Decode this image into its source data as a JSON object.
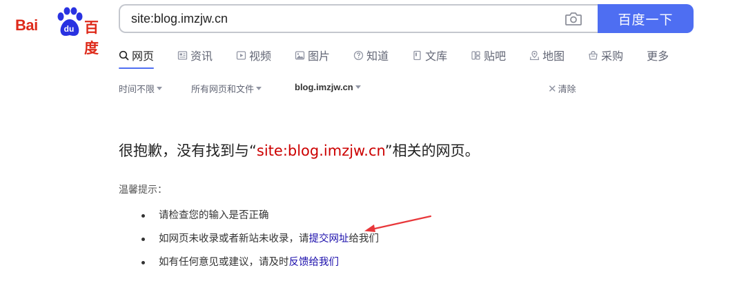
{
  "logo": {
    "text_left": "Bai",
    "paw_text": "du",
    "text_cn": "百度"
  },
  "search": {
    "query": "site:blog.imzjw.cn",
    "button_label": "百度一下",
    "camera_icon": "camera-icon"
  },
  "tabs": [
    {
      "label": "网页",
      "icon": "search-icon",
      "active": true
    },
    {
      "label": "资讯",
      "icon": "news-icon"
    },
    {
      "label": "视频",
      "icon": "video-icon"
    },
    {
      "label": "图片",
      "icon": "image-icon"
    },
    {
      "label": "知道",
      "icon": "question-icon"
    },
    {
      "label": "文库",
      "icon": "document-icon"
    },
    {
      "label": "贴吧",
      "icon": "tieba-icon"
    },
    {
      "label": "地图",
      "icon": "map-icon"
    },
    {
      "label": "采购",
      "icon": "basket-icon"
    },
    {
      "label": "更多"
    }
  ],
  "filters": {
    "time": "时间不限",
    "filetype": "所有网页和文件",
    "site": "blog.imzjw.cn",
    "clear": "清除"
  },
  "result": {
    "prefix": "很抱歉，没有找到与“",
    "query": "site:blog.imzjw.cn",
    "suffix": "”相关的网页。"
  },
  "tips": {
    "title": "温馨提示：",
    "items": [
      {
        "text": "请检查您的输入是否正确"
      },
      {
        "text_before": "如网页未收录或者新站未收录，请",
        "link": "提交网址",
        "text_after": "给我们"
      },
      {
        "text_before": "如有任何意见或建议，请及时",
        "link": "反馈给我们"
      }
    ]
  },
  "colors": {
    "brand_red": "#de2a1a",
    "brand_blue": "#4e6ef2",
    "query_red": "#cc0000",
    "link_blue": "#1a0dab",
    "annotation_arrow": "#e8373a"
  }
}
